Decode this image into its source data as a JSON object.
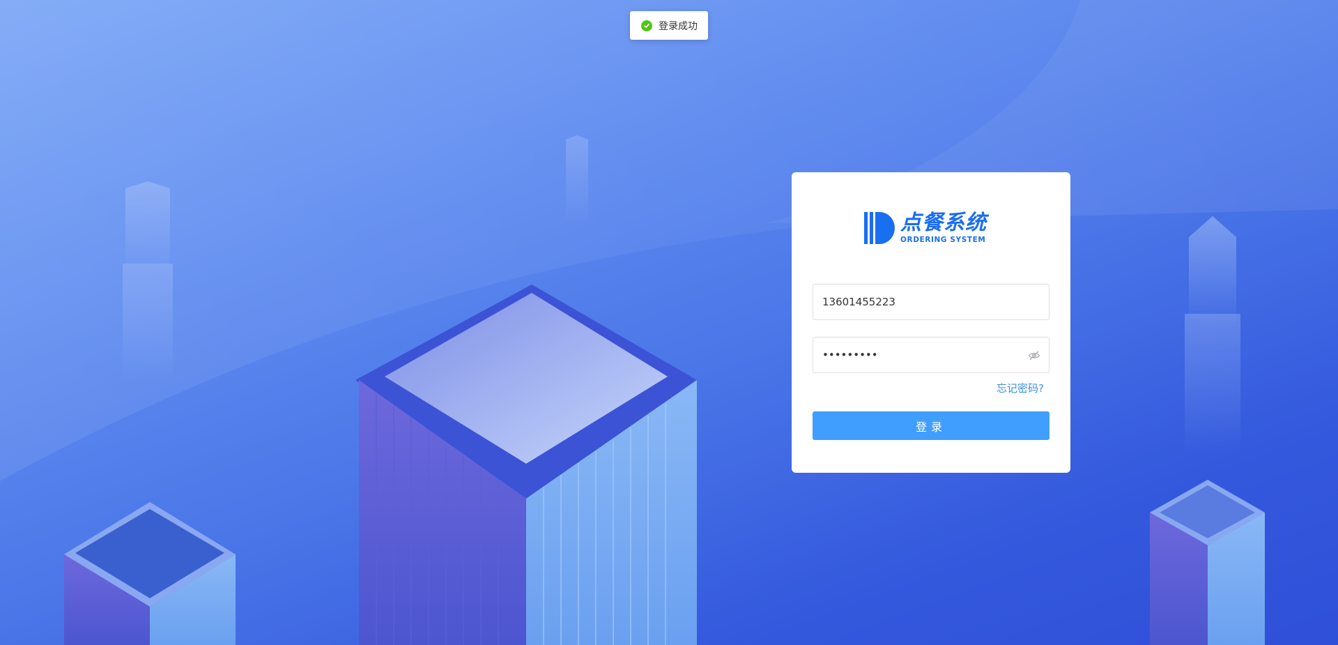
{
  "toast": {
    "message": "登录成功",
    "type": "success"
  },
  "logo": {
    "cn": "点餐系统",
    "en": "ORDERING SYSTEM",
    "color": "#1a6ef0"
  },
  "login": {
    "username_value": "13601455223",
    "password_value": "123456789",
    "forgot_label": "忘记密码?",
    "submit_label": "登录"
  },
  "icons": {
    "toast_icon": "check-circle-icon",
    "password_toggle": "eye-off-icon"
  },
  "colors": {
    "primary": "#409eff",
    "link": "#3a8ee6",
    "success": "#52c41a"
  }
}
